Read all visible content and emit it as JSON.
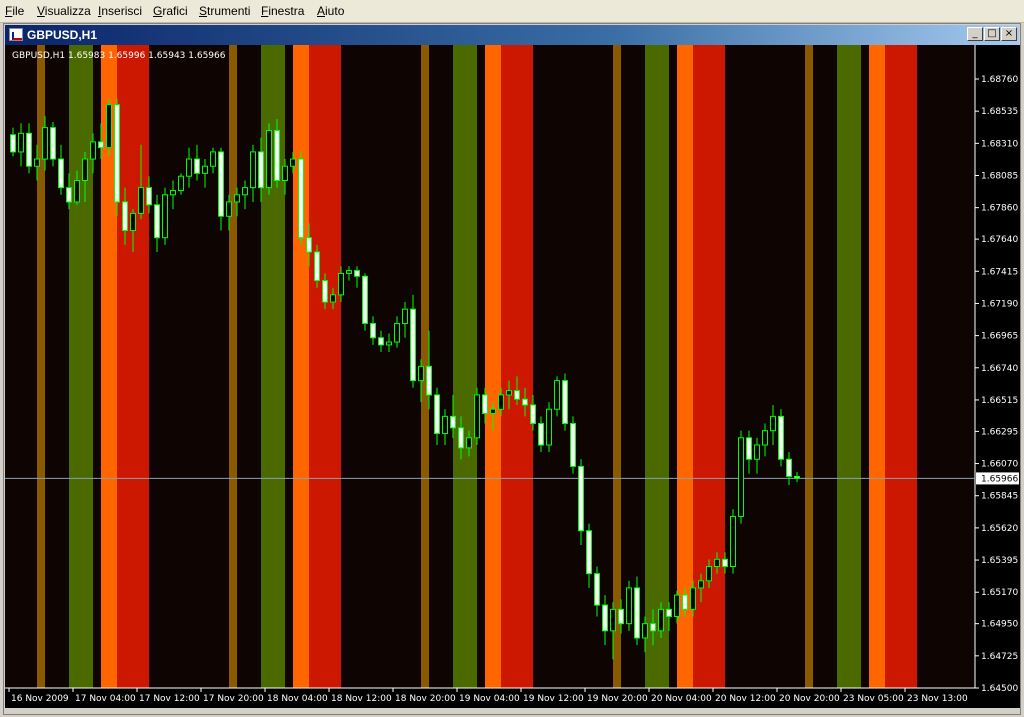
{
  "menu": [
    "File",
    "Visualizza",
    "Inserisci",
    "Grafici",
    "Strumenti",
    "Finestra",
    "Aiuto"
  ],
  "window": {
    "title": "GBPUSD,H1",
    "minimize_glyph": "_",
    "maximize_glyph": "□",
    "close_glyph": "×"
  },
  "chart_info": "GBPUSD,H1  1.65983 1.65996 1.65943 1.65966",
  "colors": {
    "background": "#000000",
    "candle_outline": "#00ff00",
    "bull_body": "#000000",
    "bear_body": "#ffffff",
    "axis_text": "#ffffff",
    "bid_line": "#8aa0b4",
    "bands": {
      "dark": "#0e0503",
      "brown": "#8a5a00",
      "olive": "#4a6a00",
      "orange": "#ff6600",
      "red": "#cc1800"
    }
  },
  "chart_data": {
    "type": "candlestick",
    "symbol": "GBPUSD",
    "timeframe": "H1",
    "current_price": "1.65966",
    "y_ticks": [
      "1.68760",
      "1.68535",
      "1.68310",
      "1.68085",
      "1.67860",
      "1.67640",
      "1.67415",
      "1.67190",
      "1.66965",
      "1.66740",
      "1.66515",
      "1.66295",
      "1.66070",
      "1.65845",
      "1.65620",
      "1.65395",
      "1.65170",
      "1.64950",
      "1.64725",
      "1.64500"
    ],
    "x_ticks": [
      "16 Nov 2009",
      "17 Nov 04:00",
      "17 Nov 12:00",
      "17 Nov 20:00",
      "18 Nov 04:00",
      "18 Nov 12:00",
      "18 Nov 20:00",
      "19 Nov 04:00",
      "19 Nov 12:00",
      "19 Nov 20:00",
      "20 Nov 04:00",
      "20 Nov 12:00",
      "20 Nov 20:00",
      "23 Nov 05:00",
      "23 Nov 13:00"
    ],
    "ylim": [
      1.645,
      1.6876
    ],
    "bands_pattern": [
      "dark",
      "brown",
      "dark",
      "olive",
      "dark",
      "orange",
      "red",
      "dark",
      "dark"
    ],
    "candles": [
      [
        1.6837,
        1.6842,
        1.6822,
        1.6825
      ],
      [
        1.6825,
        1.6845,
        1.6815,
        1.6838
      ],
      [
        1.6838,
        1.6845,
        1.681,
        1.6815
      ],
      [
        1.6815,
        1.683,
        1.6805,
        1.682
      ],
      [
        1.682,
        1.685,
        1.6812,
        1.6842
      ],
      [
        1.6842,
        1.6846,
        1.6815,
        1.682
      ],
      [
        1.682,
        1.683,
        1.6795,
        1.68
      ],
      [
        1.68,
        1.681,
        1.6785,
        1.679
      ],
      [
        1.679,
        1.6812,
        1.6788,
        1.6805
      ],
      [
        1.6805,
        1.6825,
        1.679,
        1.682
      ],
      [
        1.682,
        1.6838,
        1.681,
        1.6832
      ],
      [
        1.6832,
        1.6845,
        1.682,
        1.6828
      ],
      [
        1.6828,
        1.6862,
        1.6822,
        1.6858
      ],
      [
        1.6858,
        1.6862,
        1.678,
        1.679
      ],
      [
        1.679,
        1.68,
        1.676,
        1.677
      ],
      [
        1.677,
        1.6785,
        1.6755,
        1.6782
      ],
      [
        1.6782,
        1.683,
        1.6778,
        1.68
      ],
      [
        1.68,
        1.6808,
        1.6782,
        1.6788
      ],
      [
        1.6788,
        1.6795,
        1.6755,
        1.6765
      ],
      [
        1.6765,
        1.68,
        1.676,
        1.6795
      ],
      [
        1.6795,
        1.6805,
        1.6785,
        1.6798
      ],
      [
        1.6798,
        1.681,
        1.6795,
        1.6808
      ],
      [
        1.6808,
        1.6828,
        1.68,
        1.682
      ],
      [
        1.682,
        1.683,
        1.6805,
        1.681
      ],
      [
        1.681,
        1.682,
        1.68,
        1.6815
      ],
      [
        1.6815,
        1.6828,
        1.681,
        1.6825
      ],
      [
        1.6825,
        1.6828,
        1.677,
        1.678
      ],
      [
        1.678,
        1.6795,
        1.677,
        1.679
      ],
      [
        1.679,
        1.68,
        1.678,
        1.6795
      ],
      [
        1.6795,
        1.6805,
        1.6785,
        1.68
      ],
      [
        1.68,
        1.683,
        1.679,
        1.6825
      ],
      [
        1.6825,
        1.6835,
        1.679,
        1.68
      ],
      [
        1.68,
        1.6845,
        1.6795,
        1.684
      ],
      [
        1.684,
        1.6848,
        1.68,
        1.6805
      ],
      [
        1.6805,
        1.682,
        1.6795,
        1.6815
      ],
      [
        1.6815,
        1.6825,
        1.681,
        1.682
      ],
      [
        1.682,
        1.6825,
        1.676,
        1.6765
      ],
      [
        1.6765,
        1.6775,
        1.6745,
        1.6755
      ],
      [
        1.6755,
        1.676,
        1.673,
        1.6735
      ],
      [
        1.6735,
        1.674,
        1.6715,
        1.672
      ],
      [
        1.672,
        1.673,
        1.6715,
        1.6725
      ],
      [
        1.6725,
        1.6745,
        1.672,
        1.674
      ],
      [
        1.674,
        1.6745,
        1.6735,
        1.6742
      ],
      [
        1.6742,
        1.6745,
        1.673,
        1.6738
      ],
      [
        1.6738,
        1.674,
        1.67,
        1.6705
      ],
      [
        1.6705,
        1.671,
        1.669,
        1.6695
      ],
      [
        1.6695,
        1.67,
        1.6685,
        1.669
      ],
      [
        1.669,
        1.6698,
        1.6685,
        1.6692
      ],
      [
        1.6692,
        1.671,
        1.6688,
        1.6705
      ],
      [
        1.6705,
        1.672,
        1.6695,
        1.6715
      ],
      [
        1.6715,
        1.6725,
        1.666,
        1.6665
      ],
      [
        1.6665,
        1.668,
        1.665,
        1.6675
      ],
      [
        1.6675,
        1.67,
        1.6645,
        1.6655
      ],
      [
        1.6655,
        1.666,
        1.662,
        1.6628
      ],
      [
        1.6628,
        1.6645,
        1.662,
        1.664
      ],
      [
        1.664,
        1.6655,
        1.6625,
        1.6632
      ],
      [
        1.6632,
        1.664,
        1.661,
        1.6618
      ],
      [
        1.6618,
        1.663,
        1.6612,
        1.6625
      ],
      [
        1.6625,
        1.666,
        1.662,
        1.6655
      ],
      [
        1.6655,
        1.666,
        1.6635,
        1.6642
      ],
      [
        1.6642,
        1.665,
        1.663,
        1.6645
      ],
      [
        1.6645,
        1.666,
        1.664,
        1.6655
      ],
      [
        1.6655,
        1.6665,
        1.6645,
        1.6658
      ],
      [
        1.6658,
        1.6668,
        1.6648,
        1.6652
      ],
      [
        1.6652,
        1.666,
        1.664,
        1.6648
      ],
      [
        1.6648,
        1.6655,
        1.663,
        1.6635
      ],
      [
        1.6635,
        1.664,
        1.6615,
        1.662
      ],
      [
        1.662,
        1.665,
        1.6615,
        1.6645
      ],
      [
        1.6645,
        1.6668,
        1.664,
        1.6665
      ],
      [
        1.6665,
        1.667,
        1.663,
        1.6635
      ],
      [
        1.6635,
        1.664,
        1.66,
        1.6605
      ],
      [
        1.6605,
        1.661,
        1.655,
        1.656
      ],
      [
        1.656,
        1.6565,
        1.652,
        1.653
      ],
      [
        1.653,
        1.6535,
        1.65,
        1.6508
      ],
      [
        1.6508,
        1.6515,
        1.648,
        1.649
      ],
      [
        1.649,
        1.651,
        1.647,
        1.6505
      ],
      [
        1.6505,
        1.6512,
        1.6488,
        1.6495
      ],
      [
        1.6495,
        1.6525,
        1.649,
        1.652
      ],
      [
        1.652,
        1.6528,
        1.648,
        1.6485
      ],
      [
        1.6485,
        1.65,
        1.6475,
        1.6495
      ],
      [
        1.6495,
        1.6505,
        1.648,
        1.649
      ],
      [
        1.649,
        1.651,
        1.6485,
        1.6505
      ],
      [
        1.6505,
        1.651,
        1.649,
        1.65
      ],
      [
        1.65,
        1.6518,
        1.6495,
        1.6515
      ],
      [
        1.6515,
        1.652,
        1.65,
        1.6505
      ],
      [
        1.6505,
        1.6525,
        1.65,
        1.652
      ],
      [
        1.652,
        1.653,
        1.651,
        1.6525
      ],
      [
        1.6525,
        1.654,
        1.652,
        1.6535
      ],
      [
        1.6535,
        1.6545,
        1.653,
        1.654
      ],
      [
        1.654,
        1.6545,
        1.653,
        1.6535
      ],
      [
        1.6535,
        1.6575,
        1.653,
        1.657
      ],
      [
        1.657,
        1.663,
        1.6565,
        1.6625
      ],
      [
        1.6625,
        1.663,
        1.66,
        1.661
      ],
      [
        1.661,
        1.6625,
        1.66,
        1.662
      ],
      [
        1.662,
        1.6635,
        1.6612,
        1.663
      ],
      [
        1.663,
        1.6648,
        1.662,
        1.664
      ],
      [
        1.664,
        1.6645,
        1.6605,
        1.661
      ],
      [
        1.661,
        1.6615,
        1.6592,
        1.6598
      ],
      [
        1.6598,
        1.6601,
        1.6594,
        1.6597
      ]
    ]
  }
}
